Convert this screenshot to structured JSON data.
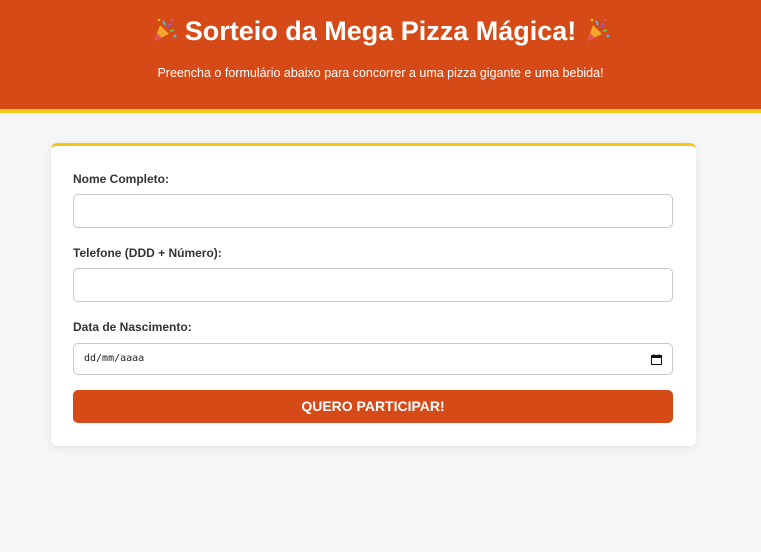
{
  "header": {
    "title": "Sorteio da Mega Pizza Mágica!",
    "subtitle": "Preencha o formulário abaixo para concorrer a uma pizza gigante e uma bebida!",
    "icon": "party-popper-icon",
    "background_color": "#d54a16",
    "accent_color": "#f5c518"
  },
  "form": {
    "name_label": "Nome Completo:",
    "name_value": "",
    "phone_label": "Telefone (DDD + Número):",
    "phone_value": "",
    "birth_label": "Data de Nascimento:",
    "birth_placeholder": "dd/mm/aaaa",
    "birth_icon": "calendar-icon",
    "submit_label": "QUERO PARTICIPAR!"
  }
}
